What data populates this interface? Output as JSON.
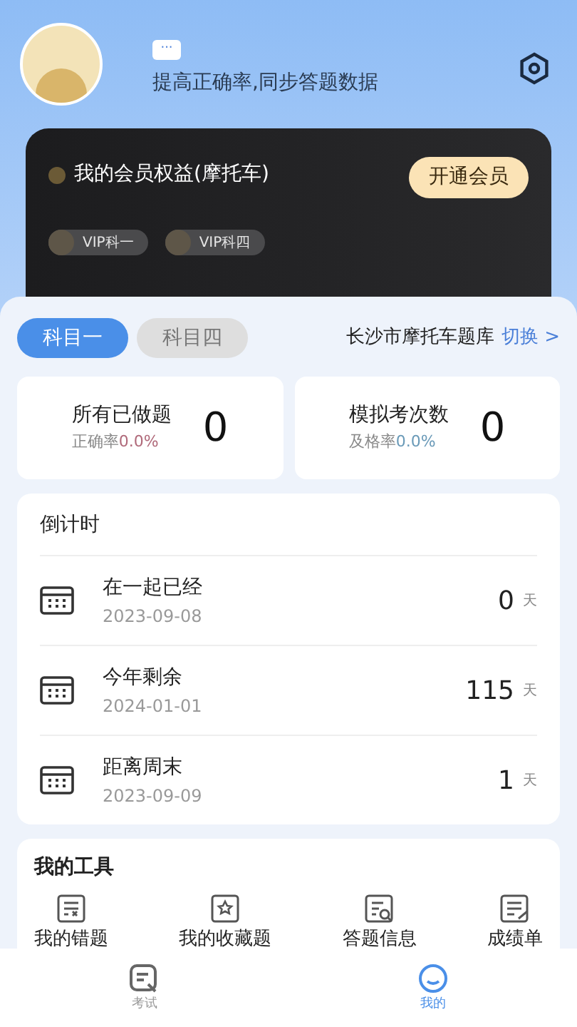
{
  "profile": {
    "bubble": "···",
    "subtitle": "提高正确率,同步答题数据"
  },
  "vip": {
    "title": "我的会员权益(摩托车)",
    "button": "开通会员",
    "badges": [
      "VIP科一",
      "VIP科四"
    ]
  },
  "subjects": [
    {
      "label": "科目一",
      "selected": true
    },
    {
      "label": "科目四",
      "selected": false
    }
  ],
  "bank": {
    "name": "长沙市摩托车题库",
    "switch": "切换 >"
  },
  "stats": [
    {
      "title": "所有已做题",
      "rate_label": "正确率",
      "rate": "0.0%",
      "color": "#b06a7a",
      "value": "0"
    },
    {
      "title": "模拟考次数",
      "rate_label": "及格率",
      "rate": "0.0%",
      "color": "#6a9ab8",
      "value": "0"
    }
  ],
  "countdown": {
    "title": "倒计时",
    "items": [
      {
        "label": "在一起已经",
        "date": "2023-09-08",
        "value": "0",
        "unit": "天"
      },
      {
        "label": "今年剩余",
        "date": "2024-01-01",
        "value": "115",
        "unit": "天"
      },
      {
        "label": "距离周末",
        "date": "2023-09-09",
        "value": "1",
        "unit": "天"
      }
    ]
  },
  "tools": {
    "title": "我的工具",
    "items": [
      {
        "label": "我的错题",
        "kind": "wrong"
      },
      {
        "label": "我的收藏题",
        "kind": "star"
      },
      {
        "label": "答题信息",
        "kind": "search"
      },
      {
        "label": "成绩单",
        "kind": "report"
      }
    ]
  },
  "nav": [
    {
      "label": "考试",
      "selected": false,
      "kind": "exam"
    },
    {
      "label": "我的",
      "selected": true,
      "kind": "me"
    }
  ]
}
